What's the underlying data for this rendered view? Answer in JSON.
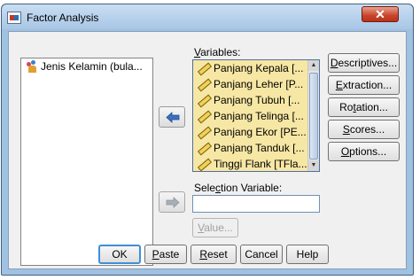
{
  "window": {
    "title": "Factor Analysis",
    "close_symbol": "✕"
  },
  "source_list": {
    "items": [
      {
        "label": "Jenis Kelamin (bula...",
        "icon": "nominal-measure-icon"
      }
    ]
  },
  "variables": {
    "label": "Variables:",
    "label_accel": "V",
    "label_rest": "ariables:",
    "items": [
      {
        "label": "Panjang Kepala [...",
        "icon": "scale-measure-icon"
      },
      {
        "label": "Panjang Leher [P...",
        "icon": "scale-measure-icon"
      },
      {
        "label": "Panjang Tubuh [...",
        "icon": "scale-measure-icon"
      },
      {
        "label": "Panjang Telinga [...",
        "icon": "scale-measure-icon"
      },
      {
        "label": "Panjang Ekor [PE...",
        "icon": "scale-measure-icon"
      },
      {
        "label": "Panjang Tanduk [...",
        "icon": "scale-measure-icon"
      },
      {
        "label": "Tinggi Flank [TFla...",
        "icon": "scale-measure-icon"
      }
    ]
  },
  "selection": {
    "label_pre": "Sele",
    "label_accel": "c",
    "label_post": "tion Variable:",
    "value": "",
    "value_button": {
      "accel": "V",
      "rest": "alue..."
    }
  },
  "side_buttons": [
    {
      "accel": "D",
      "rest": "escriptives..."
    },
    {
      "accel": "E",
      "rest": "xtraction..."
    },
    {
      "pre": "Ro",
      "accel": "t",
      "rest": "ation..."
    },
    {
      "accel": "S",
      "rest": "cores..."
    },
    {
      "accel": "O",
      "rest": "ptions..."
    }
  ],
  "bottom_buttons": {
    "ok": "OK",
    "paste": {
      "accel": "P",
      "rest": "aste"
    },
    "reset": {
      "accel": "R",
      "rest": "eset"
    },
    "cancel": "Cancel",
    "help": "Help"
  },
  "colors": {
    "variable_list_bg": "#f7e7a4",
    "titlebar": "#a8c6e6",
    "move_arrow": "#3b6fbf"
  }
}
